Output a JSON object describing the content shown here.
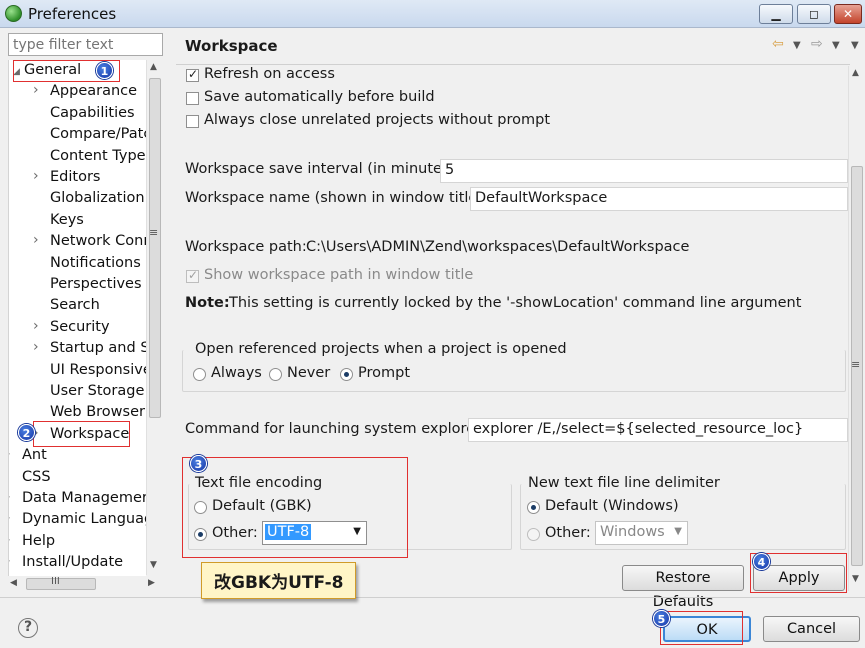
{
  "window": {
    "title": "Preferences"
  },
  "filter": {
    "placeholder": "type filter text"
  },
  "tree": {
    "items": [
      "General",
      "Appearance",
      "Capabilities",
      "Compare/Patc",
      "Content Types",
      "Editors",
      "Globalization",
      "Keys",
      "Network Conn",
      "Notifications",
      "Perspectives",
      "Search",
      "Security",
      "Startup and Sh",
      "UI Responsive",
      "User Storage S",
      "Web Browser",
      "Workspace",
      "Ant",
      "CSS",
      "Data Managemer",
      "Dynamic Languag",
      "Help",
      "Install/Update"
    ]
  },
  "pane": {
    "title": "Workspace",
    "refresh_label": "Refresh on access",
    "save_auto_label": "Save automatically before build",
    "always_close_label": "Always close unrelated projects without prompt",
    "save_interval_label": "Workspace save interval (in minutes):",
    "save_interval_value": "5",
    "ws_name_label": "Workspace name (shown in window title):",
    "ws_name_value": "DefaultWorkspace",
    "ws_path_label": "Workspace path:",
    "ws_path_value": "C:\\Users\\ADMIN\\Zend\\workspaces\\DefaultWorkspace",
    "show_path_label": "Show workspace path in window title",
    "note_bold": "Note:",
    "note_text": "This setting is currently locked by the '-showLocation' command line argument",
    "open_ref_label": "Open referenced projects when a project is opened",
    "radio_always": "Always",
    "radio_never": "Never",
    "radio_prompt": "Prompt",
    "cmd_label": "Command for launching system explorer:",
    "cmd_value": "explorer /E,/select=${selected_resource_loc}",
    "encoding_title": "Text file encoding",
    "enc_default": "Default (GBK)",
    "enc_other": "Other:",
    "enc_other_value": "UTF-8",
    "delim_title": "New text file line delimiter",
    "delim_default": "Default (Windows)",
    "delim_other": "Other:",
    "delim_other_value": "Windows",
    "restore_button": "Restore Defaults",
    "apply_button": "Apply"
  },
  "footer": {
    "ok_button": "OK",
    "cancel_button": "Cancel",
    "help_glyph": "?"
  },
  "annotations": {
    "callout_text": "改GBK为UTF-8",
    "badges": [
      "1",
      "2",
      "3",
      "4",
      "5"
    ]
  },
  "colors": {
    "annotation_red": "#e03030",
    "badge_blue": "#1636a8",
    "selection_blue": "#3399ff"
  }
}
